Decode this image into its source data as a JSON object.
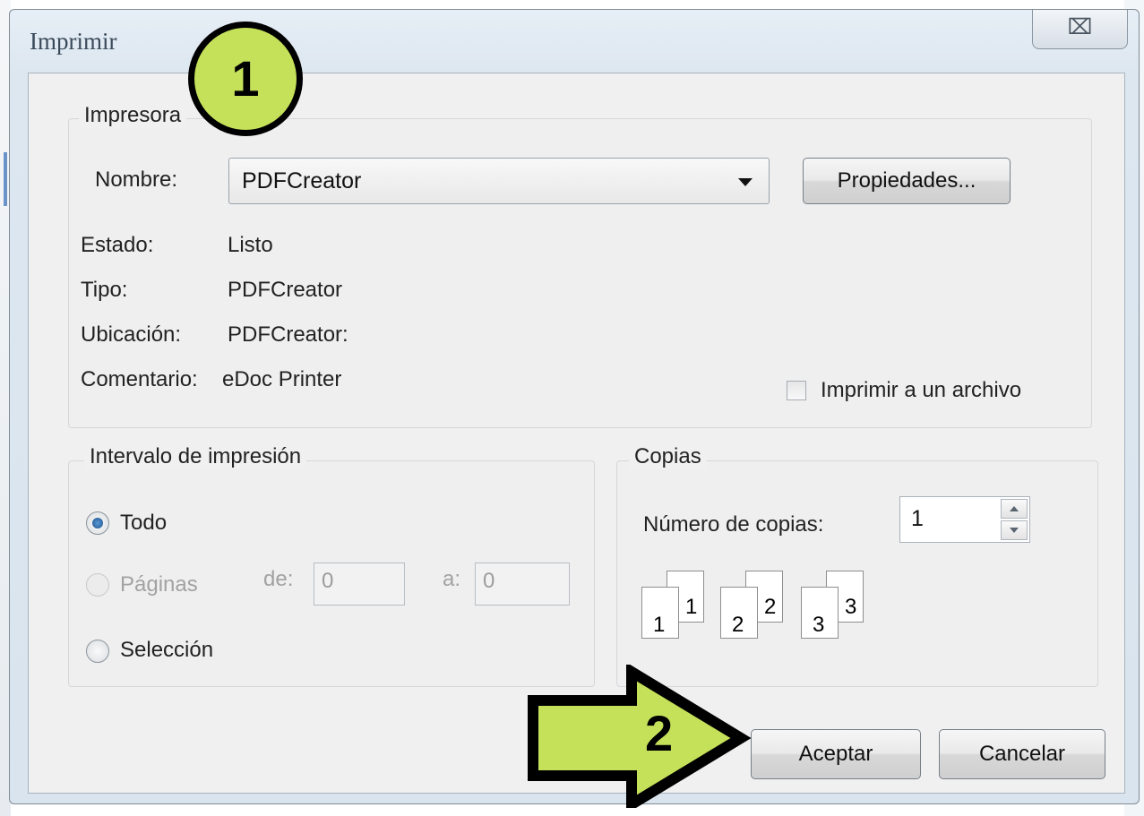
{
  "window": {
    "title": "Imprimir",
    "close_glyph": "⌧"
  },
  "printer": {
    "group_label": "Impresora",
    "name_label": "Nombre:",
    "name_value": "PDFCreator",
    "properties_button": "Propiedades...",
    "status_label": "Estado:",
    "status_value": "Listo",
    "type_label": "Tipo:",
    "type_value": "PDFCreator",
    "location_label": "Ubicación:",
    "location_value": "PDFCreator:",
    "comment_label": "Comentario:",
    "comment_value": "eDoc Printer",
    "print_to_file_label": "Imprimir a un archivo",
    "print_to_file_checked": false
  },
  "range": {
    "group_label": "Intervalo de impresión",
    "all_label": "Todo",
    "all_selected": true,
    "pages_label": "Páginas",
    "from_label": "de:",
    "from_value": "0",
    "to_label": "a:",
    "to_value": "0",
    "selection_label": "Selección"
  },
  "copies": {
    "group_label": "Copias",
    "count_label": "Número de copias:",
    "count_value": "1",
    "collate_pages": [
      {
        "back": "1",
        "front": "1"
      },
      {
        "back": "2",
        "front": "2"
      },
      {
        "back": "3",
        "front": "3"
      }
    ]
  },
  "footer": {
    "ok_button": "Aceptar",
    "cancel_button": "Cancelar"
  },
  "annotations": {
    "step1": "1",
    "step2": "2",
    "accent_color": "#c5e15a"
  }
}
